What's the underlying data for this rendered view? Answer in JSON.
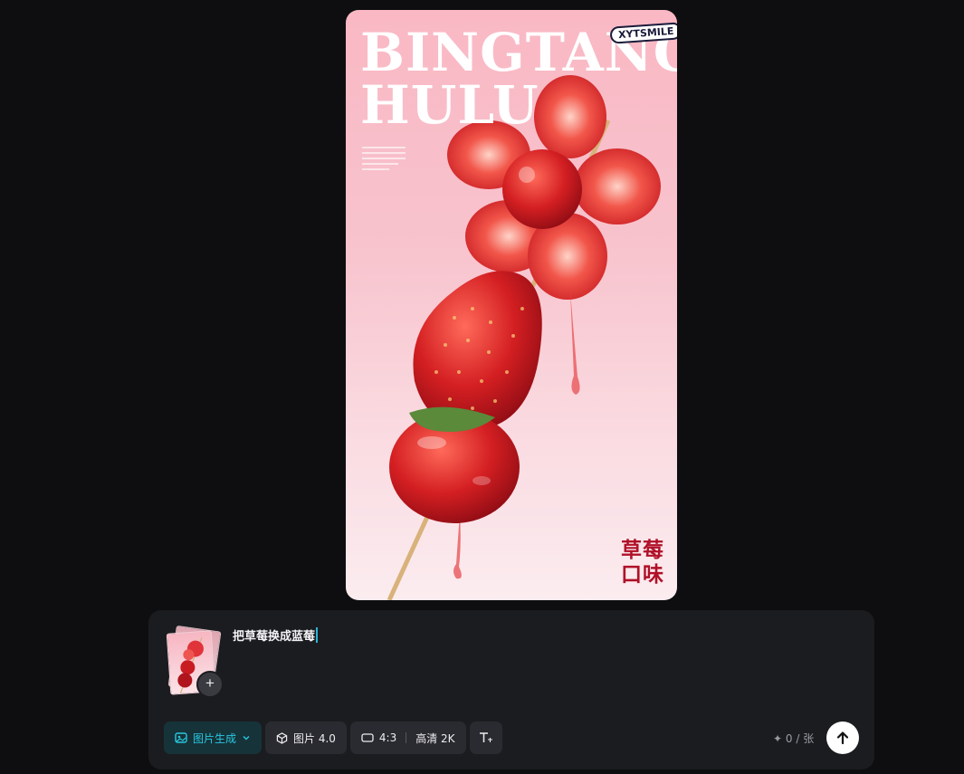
{
  "preview": {
    "title": "BINGTANG\nHULU",
    "brand": "XYTSMILE",
    "flavor": "草莓\n口味"
  },
  "composer": {
    "prompt": "把草莓换成蓝莓",
    "add_label": "+",
    "toolbar": {
      "mode": "图片生成",
      "model": "图片 4.0",
      "ratio": "4:3",
      "quality": "高清 2K"
    },
    "quota": "0 / 张"
  },
  "colors": {
    "accent": "#29c7e0",
    "panel": "#1b1c20",
    "background": "#0e0e10"
  }
}
